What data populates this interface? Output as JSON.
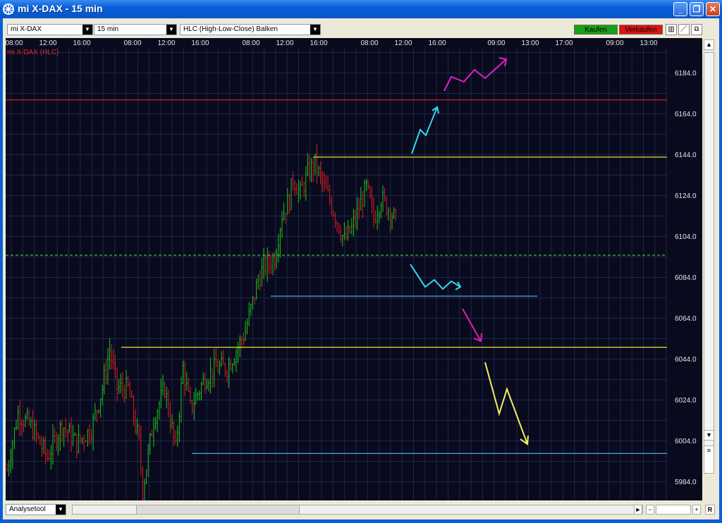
{
  "window": {
    "title": "mi X-DAX - 15 min"
  },
  "toolbar": {
    "instrument": "mi X-DAX",
    "interval": "15 min",
    "chart_type": "HLC (High-Low-Close) Balken",
    "buy_label": "Kaufen",
    "sell_label": "Verkaufen"
  },
  "bottom": {
    "tool_select": "Analysetool",
    "r_button": "R",
    "minus": "−",
    "plus": "+"
  },
  "colors": {
    "background": "#0a0a1e",
    "up": "#19c819",
    "down": "#dc1e1e",
    "grid": "#1e2c4a",
    "accent_title": "#0a5fd8"
  },
  "chart_data": {
    "type": "bar",
    "title": "",
    "legend": "mi X-DAX (HLC)",
    "time_labels": [
      "08:00",
      "12:00",
      "16:00",
      "08:00",
      "12:00",
      "16:00",
      "08:00",
      "12:00",
      "16:00",
      "08:00",
      "12:00",
      "16:00",
      "09:00",
      "13:00",
      "17:00",
      "09:00",
      "13:00"
    ],
    "y_ticks": [
      "6184.0",
      "6164.0",
      "6144.0",
      "6124.0",
      "6104.0",
      "6084.0",
      "6064.0",
      "6044.0",
      "6024.0",
      "6004.0",
      "5984.0"
    ],
    "ylim": [
      5980,
      6200
    ],
    "grid": true,
    "series_summary": {
      "start_close": 5990,
      "mid_low": 5977,
      "breakout_to": 6143,
      "last_close": 6110
    },
    "horizontal_lines": [
      {
        "level": 6171,
        "color": "#e0202a",
        "style": "solid",
        "range": "full"
      },
      {
        "level": 6143,
        "color": "#e8e02a",
        "style": "solid",
        "range": "from-high"
      },
      {
        "level": 6095,
        "color": "#3cb44a",
        "style": "dashed",
        "range": "full"
      },
      {
        "level": 6075,
        "color": "#4aa8e8",
        "style": "solid",
        "range": "partial"
      },
      {
        "level": 6050,
        "color": "#e8e02a",
        "style": "solid",
        "range": "from-left"
      },
      {
        "level": 5998,
        "color": "#4aa8e8",
        "style": "solid",
        "range": "from-low"
      }
    ],
    "annotations": [
      {
        "name": "magenta-zigzag-up",
        "color": "#e020c8"
      },
      {
        "name": "cyan-arrow-up",
        "color": "#30d8f0"
      },
      {
        "name": "cyan-zigzag-down",
        "color": "#30d8f0"
      },
      {
        "name": "magenta-arrow-down",
        "color": "#e020a8"
      },
      {
        "name": "yellow-zigzag-down",
        "color": "#f0f060"
      }
    ]
  }
}
